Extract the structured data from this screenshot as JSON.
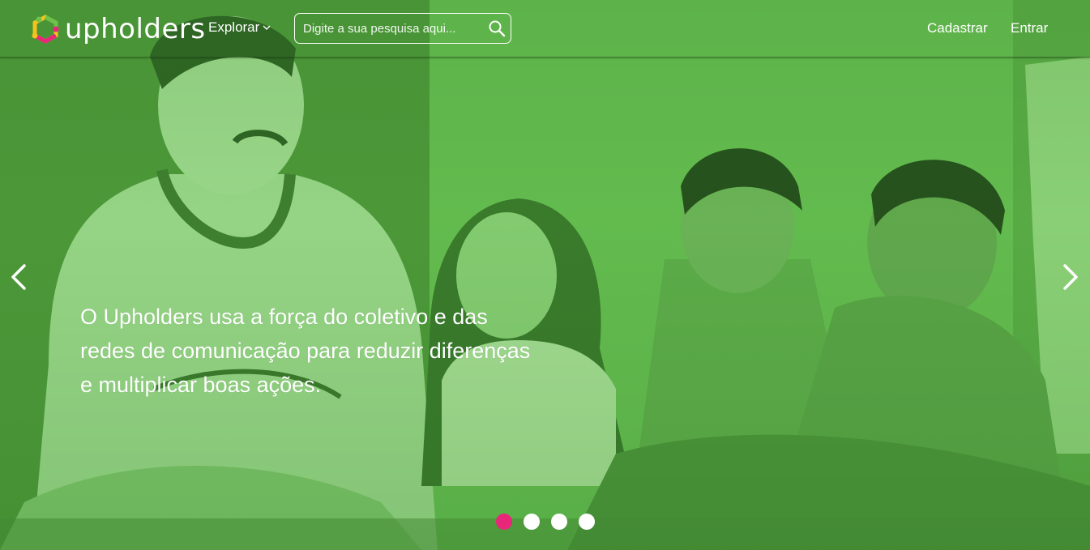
{
  "brand": {
    "name": "upholders"
  },
  "header": {
    "explore_label": "Explorar",
    "search": {
      "placeholder": "Digite a sua pesquisa aqui...",
      "value": ""
    },
    "signup_label": "Cadastrar",
    "login_label": "Entrar"
  },
  "hero": {
    "text": "O Upholders usa a força do coletivo e das redes de comunicação para reduzir diferenças e multiplicar boas ações.",
    "slides_total": 4,
    "active_slide": 1
  },
  "icons": {
    "search": "search-icon",
    "chevron": "chevron-down-icon",
    "prev": "chevron-left-icon",
    "next": "chevron-right-icon",
    "logo": "upholders-logo-icon"
  },
  "colors": {
    "overlay_green": "#5cb84a",
    "active_dot": "#e8267a",
    "inactive_dot": "#ffffff",
    "logo_yellow": "#f6c21b",
    "logo_pink": "#e8267a",
    "logo_green": "#6cc24a"
  }
}
